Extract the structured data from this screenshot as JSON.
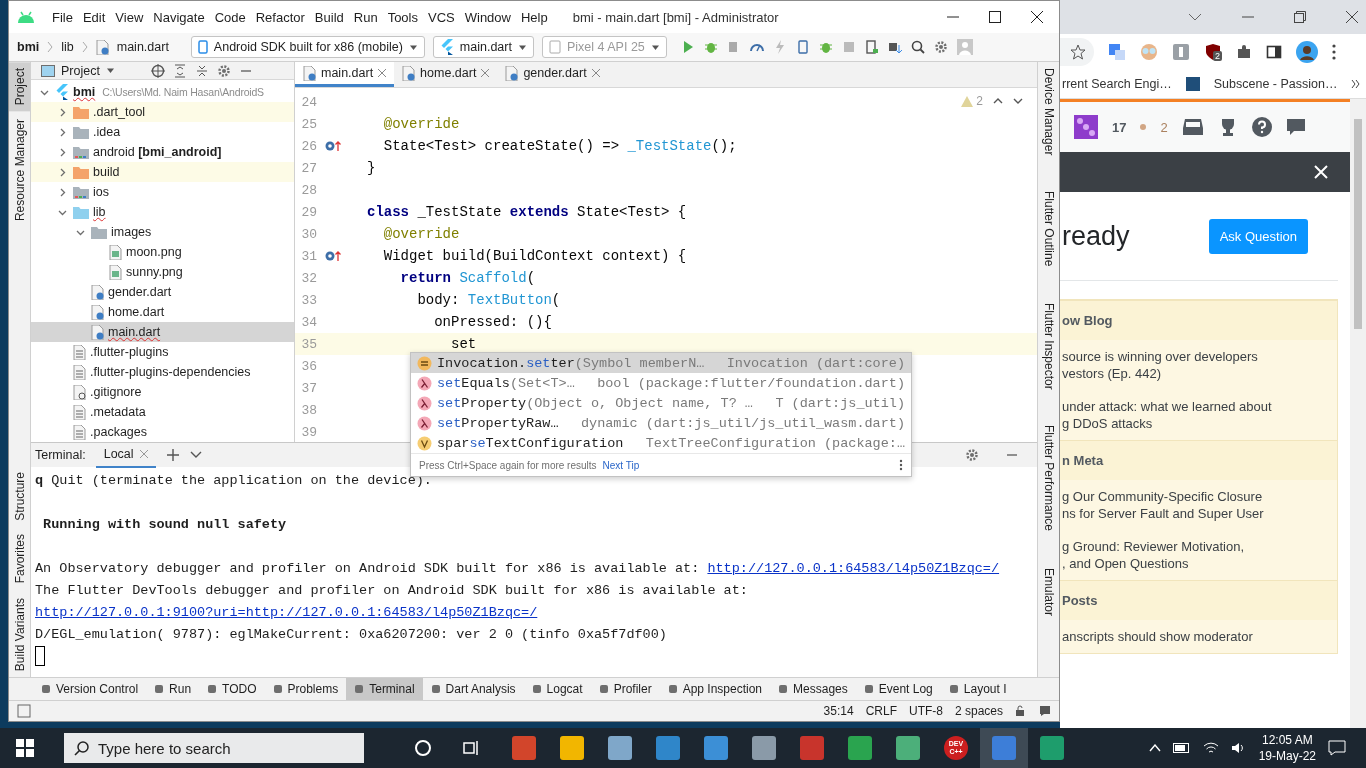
{
  "ide": {
    "title": "bmi - main.dart [bmi] - Administrator",
    "menu": [
      "File",
      "Edit",
      "View",
      "Navigate",
      "Code",
      "Refactor",
      "Build",
      "Run",
      "Tools",
      "VCS",
      "Window",
      "Help"
    ],
    "breadcrumbs": [
      "bmi",
      "lib",
      "main.dart"
    ],
    "run_config": "Android SDK built for x86 (mobile)",
    "file_config": "main.dart",
    "device": {
      "label": "Pixel 4 API 25",
      "disabled": true
    },
    "left_strip": [
      {
        "label": "Project",
        "selected": true
      },
      {
        "label": "Resource Manager",
        "selected": false
      },
      {
        "label": "Structure",
        "selected": false
      },
      {
        "label": "Favorites",
        "selected": false
      },
      {
        "label": "Build Variants",
        "selected": false
      }
    ],
    "right_strip": [
      {
        "label": "Device Manager",
        "selected": false
      },
      {
        "label": "Flutter Outline",
        "selected": false
      },
      {
        "label": "Flutter Inspector",
        "selected": false
      },
      {
        "label": "Flutter Performance",
        "selected": false
      },
      {
        "label": "Emulator",
        "selected": false
      }
    ],
    "project_title": "Project",
    "tree": [
      {
        "name": "bmi",
        "detail": "C:\\Users\\Md. Naim Hasan\\AndroidS",
        "kind": "flutter",
        "expanded": true,
        "selected": false,
        "error": true,
        "children": [
          {
            "name": ".dart_tool",
            "kind": "excluded",
            "expanded": false,
            "selected": false,
            "error": false
          },
          {
            "name": ".idea",
            "kind": "config",
            "expanded": false,
            "selected": false,
            "error": false
          },
          {
            "name": "android **[bmi_android]**",
            "kind": "module",
            "expanded": false,
            "selected": false,
            "error": false
          },
          {
            "name": "build",
            "kind": "excluded",
            "expanded": false,
            "selected": false,
            "error": false
          },
          {
            "name": "ios",
            "kind": "module",
            "expanded": false,
            "selected": false,
            "error": false
          },
          {
            "name": "lib",
            "kind": "source",
            "expanded": true,
            "selected": false,
            "error": true,
            "children": [
              {
                "name": "images",
                "kind": "folder",
                "expanded": true,
                "selected": false,
                "error": false,
                "children": [
                  {
                    "name": "moon.png",
                    "kind": "image",
                    "selected": false,
                    "error": false
                  },
                  {
                    "name": "sunny.png",
                    "kind": "image",
                    "selected": false,
                    "error": false
                  }
                ]
              },
              {
                "name": "gender.dart",
                "kind": "dart",
                "selected": false,
                "error": false
              },
              {
                "name": "home.dart",
                "kind": "dart",
                "selected": false,
                "error": false
              },
              {
                "name": "main.dart",
                "kind": "dart",
                "selected": true,
                "error": true
              }
            ]
          },
          {
            "name": ".flutter-plugins",
            "kind": "text",
            "selected": false,
            "error": false
          },
          {
            "name": ".flutter-plugins-dependencies",
            "kind": "text",
            "selected": false,
            "error": false
          },
          {
            "name": ".gitignore",
            "kind": "ignore",
            "selected": false,
            "error": false
          },
          {
            "name": ".metadata",
            "kind": "text",
            "selected": false,
            "error": false
          },
          {
            "name": ".packages",
            "kind": "text",
            "selected": false,
            "error": false
          }
        ]
      }
    ],
    "tabs": [
      {
        "label": "main.dart",
        "selected": true
      },
      {
        "label": "home.dart",
        "selected": false
      },
      {
        "label": "gender.dart",
        "selected": false
      }
    ],
    "warnings": "2",
    "lines": [
      {
        "number": "24",
        "kind": "plain",
        "current": false
      },
      {
        "number": "25",
        "kind": "plain",
        "current": false,
        "tokens": [
          {
            "text": "  @override",
            "kind": "annotation"
          }
        ]
      },
      {
        "number": "26",
        "kind": "override",
        "current": false,
        "tokens": [
          {
            "text": "  State<Test> createState() => ",
            "kind": "plain"
          },
          {
            "text": "_TestState",
            "kind": "type"
          },
          {
            "text": "();",
            "kind": "plain"
          }
        ]
      },
      {
        "number": "27",
        "kind": "plain",
        "current": false,
        "tokens": [
          {
            "text": "}",
            "kind": "plain"
          }
        ]
      },
      {
        "number": "28",
        "kind": "plain",
        "current": false
      },
      {
        "number": "29",
        "kind": "plain",
        "current": false,
        "tokens": [
          {
            "text": "class",
            "kind": "keyword"
          },
          {
            "text": " _TestState ",
            "kind": "plain"
          },
          {
            "text": "extends",
            "kind": "keyword"
          },
          {
            "text": " State<Test> {",
            "kind": "plain"
          }
        ]
      },
      {
        "number": "30",
        "kind": "plain",
        "current": false,
        "tokens": [
          {
            "text": "  @override",
            "kind": "annotation"
          }
        ]
      },
      {
        "number": "31",
        "kind": "override",
        "current": false,
        "tokens": [
          {
            "text": "  Widget build(BuildContext context) {",
            "kind": "plain"
          }
        ]
      },
      {
        "number": "32",
        "kind": "plain",
        "current": false,
        "tokens": [
          {
            "text": "    return",
            "kind": "keyword"
          },
          {
            "text": " Scaffold",
            "kind": "type"
          },
          {
            "text": "(",
            "kind": "plain"
          }
        ]
      },
      {
        "number": "33",
        "kind": "plain",
        "current": false,
        "tokens": [
          {
            "text": "      body: ",
            "kind": "plain"
          },
          {
            "text": "TextButton",
            "kind": "type"
          },
          {
            "text": "(",
            "kind": "plain"
          }
        ]
      },
      {
        "number": "34",
        "kind": "plain",
        "current": false,
        "tokens": [
          {
            "text": "        onPressed: (){",
            "kind": "plain"
          }
        ]
      },
      {
        "number": "35",
        "kind": "plain",
        "current": true,
        "tokens": [
          {
            "text": "          set",
            "kind": "plain"
          }
        ]
      },
      {
        "number": "36",
        "kind": "plain",
        "current": false
      },
      {
        "number": "37",
        "kind": "plain",
        "current": false
      },
      {
        "number": "38",
        "kind": "plain",
        "current": false
      },
      {
        "number": "39",
        "kind": "plain",
        "current": false
      }
    ],
    "completion": {
      "items": [
        {
          "kind": "field",
          "prefix": "Invocation.",
          "match": "set",
          "rest": "ter",
          "params": "(Symbol memberN…",
          "type": "Invocation (dart:core)",
          "selected": true
        },
        {
          "kind": "function",
          "match": "set",
          "rest": "Equals",
          "params": "(Set<T>…",
          "type": "bool (package:flutter/foundation.dart)",
          "selected": false
        },
        {
          "kind": "function",
          "match": "set",
          "rest": "Property",
          "params": "(Object o, Object name, T? …",
          "type": "T (dart:js_util)",
          "selected": false
        },
        {
          "kind": "function",
          "match": "set",
          "rest": "PropertyRaw…",
          "type": "dynamic (dart:js_util/js_util_wasm.dart)",
          "selected": false
        },
        {
          "kind": "variable",
          "prefix": "spar",
          "match": "se",
          "rest": "TextConfiguration",
          "type": "TextTreeConfiguration (package:…",
          "selected": false
        }
      ],
      "hint": "Press Ctrl+Space again for more results",
      "tip_link": "Next Tip"
    },
    "terminal": {
      "title": "Terminal:",
      "tabs": [
        {
          "label": "Local",
          "selected": true
        }
      ],
      "lines": [
        {
          "kind": "text",
          "segments": [
            {
              "text": "q",
              "kind": "bold"
            },
            {
              "text": " Quit (terminate the application on the device).",
              "kind": "plain"
            }
          ]
        },
        {
          "kind": "blank"
        },
        {
          "kind": "text",
          "segments": [
            {
              "text": " Running with sound null safety",
              "kind": "bold"
            }
          ]
        },
        {
          "kind": "blank"
        },
        {
          "kind": "text",
          "segments": [
            {
              "text": "An Observatory debugger and profiler on Android SDK built for x86 is available at: ",
              "kind": "plain"
            },
            {
              "text": "http://127.0.0.1:64583/l4p50Z1Bzqc=/",
              "kind": "link"
            }
          ]
        },
        {
          "kind": "text",
          "segments": [
            {
              "text": "The Flutter DevTools debugger and profiler on Android SDK built for x86 is available at:",
              "kind": "plain"
            }
          ]
        },
        {
          "kind": "text",
          "segments": [
            {
              "text": "http://127.0.0.1:9100?uri=http://127.0.0.1:64583/l4p50Z1Bzqc=/",
              "kind": "link"
            }
          ]
        },
        {
          "kind": "text",
          "segments": [
            {
              "text": "D/EGL_emulation( 9787): eglMakeCurrent: 0xa6207200: ver 2 0 (tinfo 0xa5f7df00)",
              "kind": "plain"
            }
          ]
        }
      ]
    },
    "tool_windows": [
      {
        "label": "Version Control",
        "selected": false
      },
      {
        "label": "Run",
        "selected": false
      },
      {
        "label": "TODO",
        "selected": false
      },
      {
        "label": "Problems",
        "selected": false
      },
      {
        "label": "Terminal",
        "selected": true
      },
      {
        "label": "Dart Analysis",
        "selected": false
      },
      {
        "label": "Logcat",
        "selected": false
      },
      {
        "label": "Profiler",
        "selected": false
      },
      {
        "label": "App Inspection",
        "selected": false
      },
      {
        "label": "Messages",
        "selected": false
      },
      {
        "label": "Event Log",
        "selected": false
      },
      {
        "label": "Layout I",
        "selected": false
      }
    ],
    "status": [
      "35:14",
      "CRLF",
      "UTF-8",
      "2 spaces"
    ]
  },
  "browser": {
    "bookmarks": [
      "rrent Search Engi…",
      "Subscene - Passion…"
    ],
    "extension_badge": "2",
    "reputation": "17",
    "bronze": "2",
    "heading": "ready",
    "ask_button": "Ask Question",
    "sections": [
      {
        "heading": "ow Blog",
        "items": [
          "source is winning over developers\nvestors (Ep. 442)",
          "under attack: what we learned about\ng DDoS attacks"
        ]
      },
      {
        "heading": "n Meta",
        "items": [
          "g Our Community-Specific Closure\nns for Server Fault and Super User",
          "g Ground: Reviewer Motivation,\n, and Open Questions"
        ]
      },
      {
        "heading": "Posts",
        "items": [
          "anscripts should show moderator"
        ]
      }
    ]
  },
  "taskbar": {
    "search_placeholder": "Type here to search",
    "time": "12:05 AM",
    "date": "19-May-22",
    "apps": [
      {
        "color": "#d2452b",
        "selected": false
      },
      {
        "color": "#f2b600",
        "selected": false
      },
      {
        "color": "#7fa7c9",
        "selected": false
      },
      {
        "color": "#2f86c9",
        "selected": false
      },
      {
        "color": "#3c8fd6",
        "selected": false
      },
      {
        "color": "#8a9aa8",
        "selected": false
      },
      {
        "color": "#c8342c",
        "selected": false
      },
      {
        "color": "#2aa44f",
        "selected": false
      },
      {
        "color": "#4caf7a",
        "selected": false
      },
      {
        "color": "#cc1f1f",
        "selected": false,
        "label": "DEV C++"
      },
      {
        "color": "#3d7ed8",
        "selected": true
      },
      {
        "color": "#1e9d6c",
        "selected": false
      }
    ]
  }
}
